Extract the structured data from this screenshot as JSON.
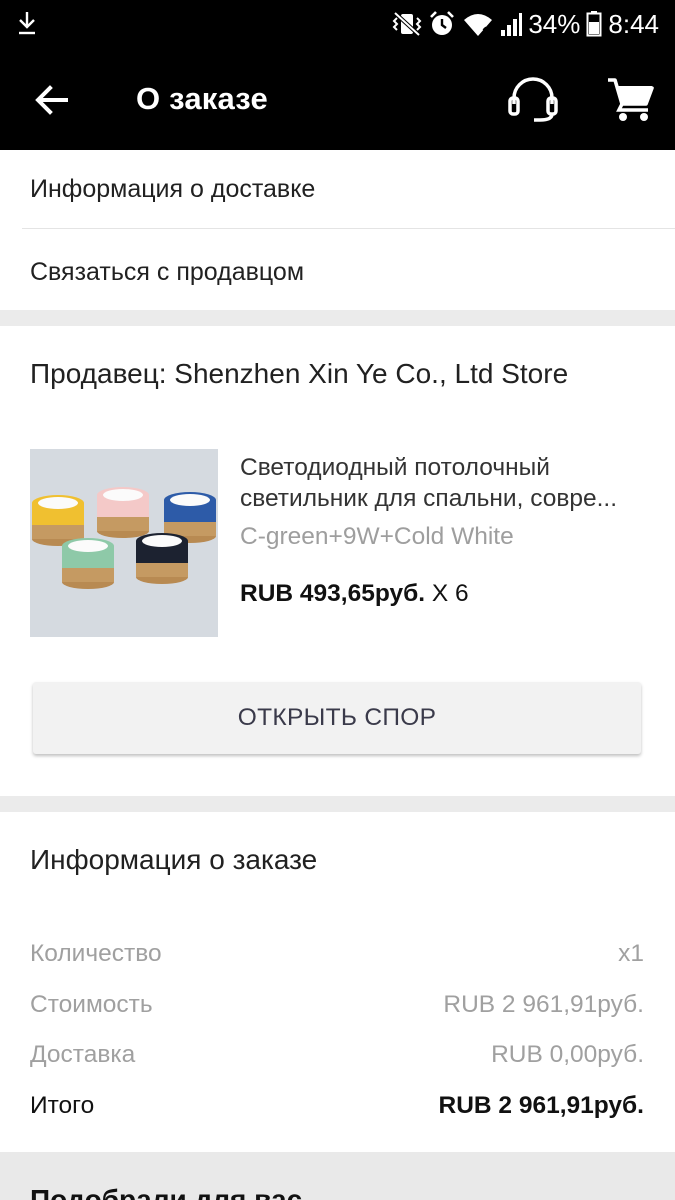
{
  "status_bar": {
    "download_icon": "download-arrow-icon",
    "icons": [
      "vibrate-icon",
      "alarm-icon",
      "wifi-icon",
      "signal-icon"
    ],
    "battery_percent": "34%",
    "time": "8:44"
  },
  "app_bar": {
    "title": "О заказе",
    "back_icon": "arrow-left-icon",
    "support_icon": "headset-icon",
    "cart_icon": "shopping-cart-icon"
  },
  "links": {
    "delivery_info": "Информация о доставке",
    "contact_seller": "Связаться с продавцом"
  },
  "seller": {
    "label": "Продавец: Shenzhen Xin Ye Co., Ltd Store"
  },
  "product": {
    "name_line1": "Светодиодный потолочный",
    "name_line2": "светильник для спальни, совре...",
    "sku": "C-green+9W+Cold White",
    "price": "RUB 493,65руб.",
    "quantity": "X 6",
    "thumbnail_colors": [
      "#f0c030",
      "#f4c9c8",
      "#2d5ba8",
      "#8ec9a8",
      "#1c2230"
    ]
  },
  "dispute_button": "ОТКРЫТЬ СПОР",
  "order_info": {
    "title": "Информация о заказе",
    "rows": [
      {
        "label": "Количество",
        "value": "x1"
      },
      {
        "label": "Стоимость",
        "value": "RUB 2 961,91руб."
      },
      {
        "label": "Доставка",
        "value": "RUB 0,00руб."
      }
    ],
    "total": {
      "label": "Итого",
      "value": "RUB 2 961,91руб."
    }
  },
  "recommendations": {
    "title": "Подобрали для вас"
  }
}
